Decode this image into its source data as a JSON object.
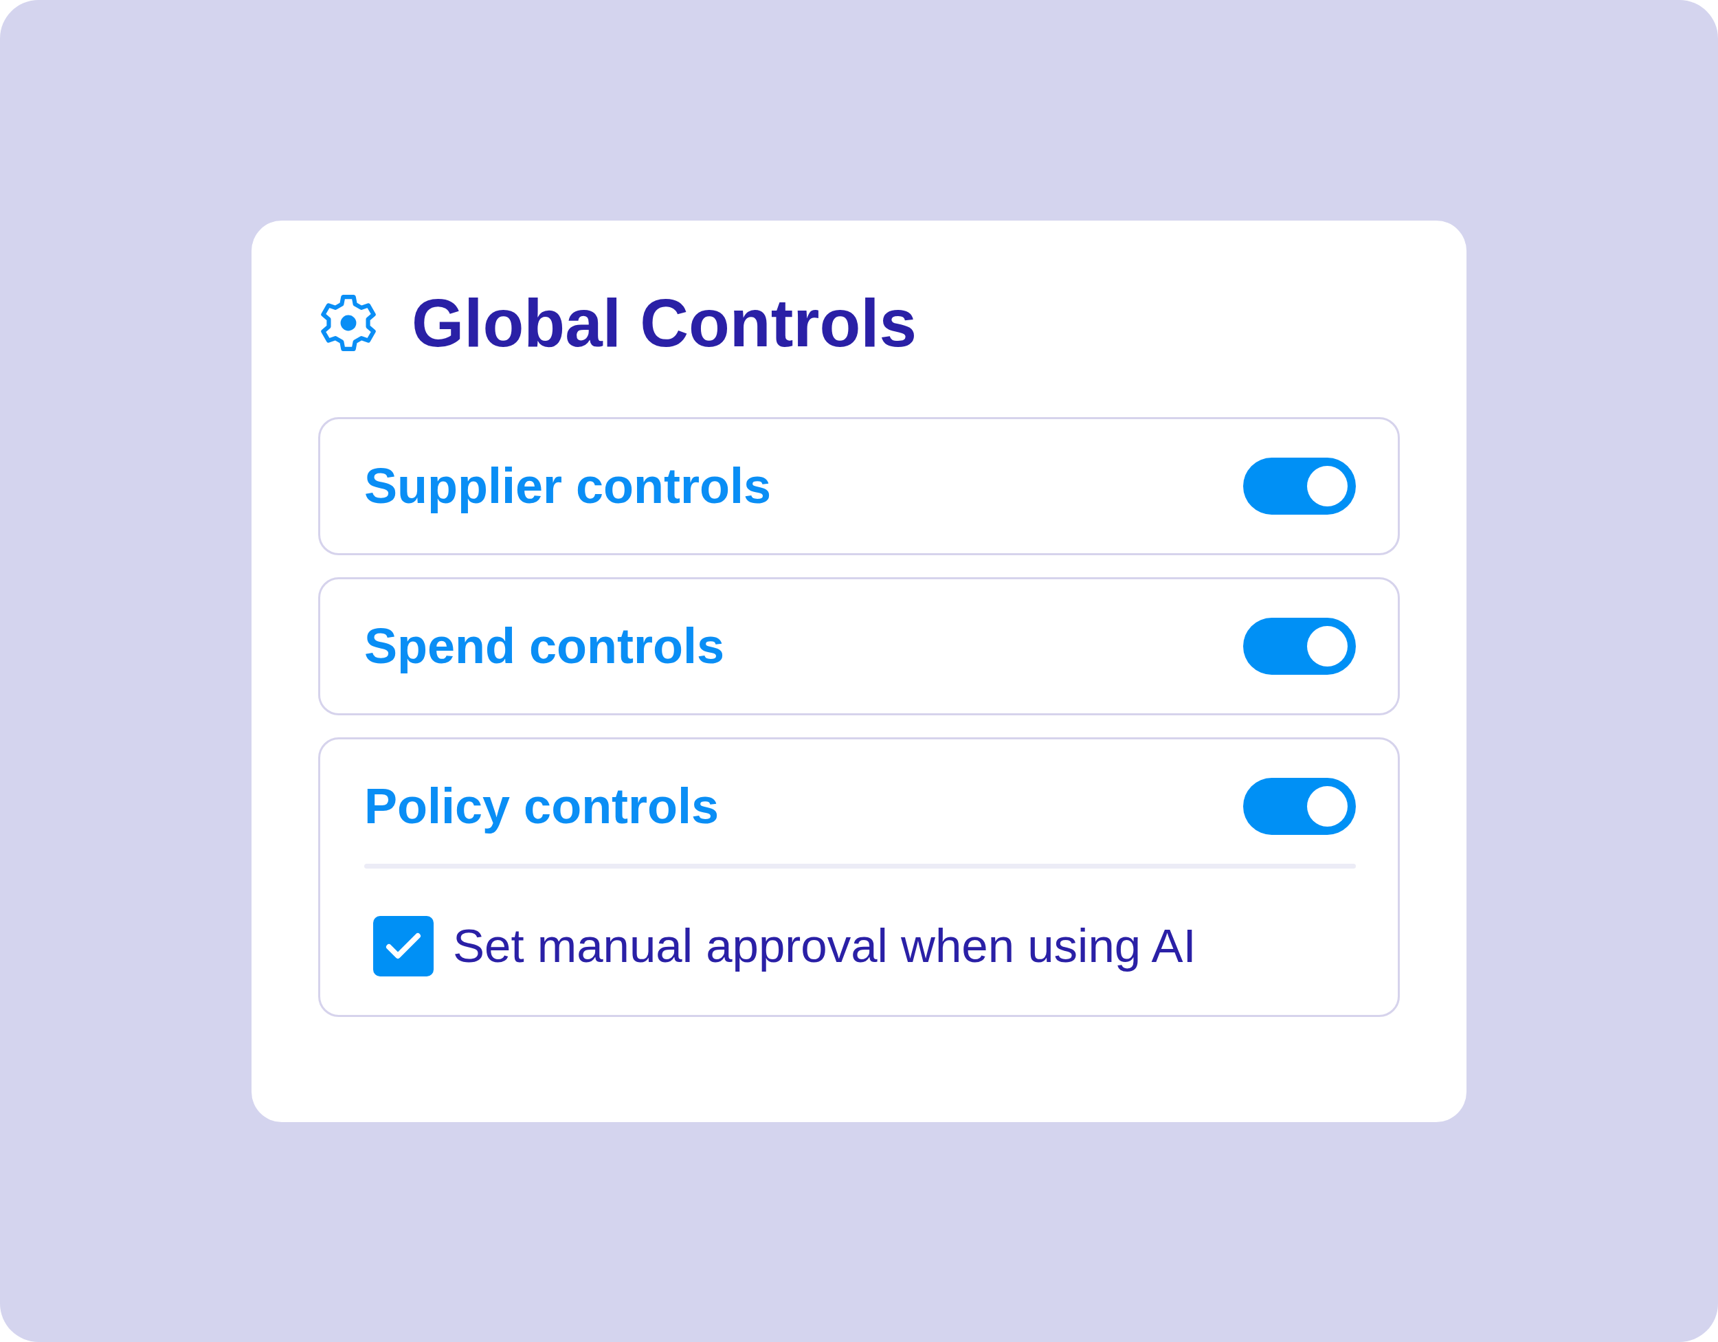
{
  "panel": {
    "title": "Global Controls"
  },
  "controls": [
    {
      "label": "Supplier controls",
      "on": true
    },
    {
      "label": "Spend controls",
      "on": true
    },
    {
      "label": "Policy controls",
      "on": true,
      "options": [
        {
          "label": "Set manual approval when using AI",
          "checked": true
        }
      ]
    }
  ]
}
